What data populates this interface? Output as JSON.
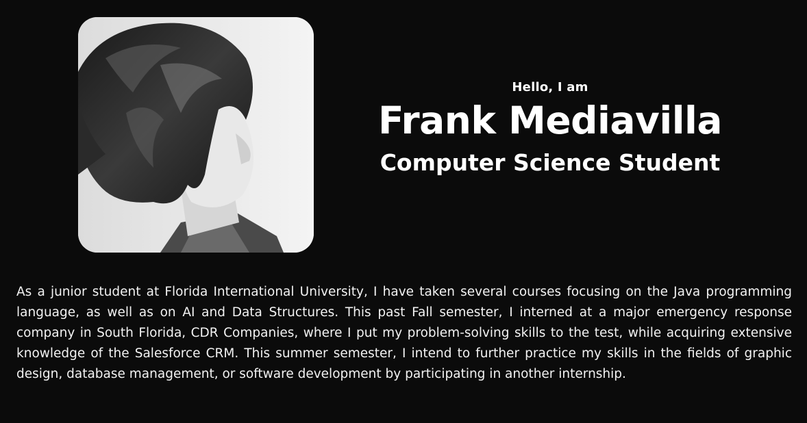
{
  "profile": {
    "photo_alt": "Portrait photo",
    "greeting": "Hello, I am",
    "name": "Frank Mediavilla",
    "role": "Computer Science Student",
    "bio": "As a junior student at Florida International University, I have taken several courses focusing on the Java programming language, as well as on AI and Data Structures. This past Fall semester, I interned at a major emergency response company in South Florida, CDR Companies, where I put my problem-solving skills to the test, while acquiring extensive knowledge of the Salesforce CRM. This summer semester, I intend to further practice my skills in the fields of graphic design, database management, or software development by participating in another internship."
  },
  "colors": {
    "background": "#0b0b0b",
    "text": "#ffffff"
  }
}
